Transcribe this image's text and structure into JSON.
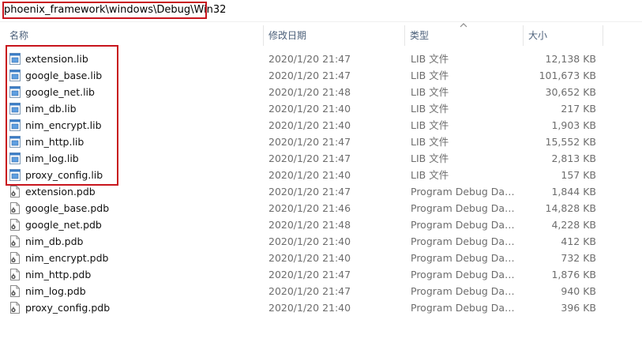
{
  "address": {
    "path": "phoenix_framework\\windows\\Debug\\Win32"
  },
  "columns": {
    "name": "名称",
    "date": "修改日期",
    "type": "类型",
    "size": "大小"
  },
  "files": [
    {
      "name": "extension.lib",
      "date": "2020/1/20 21:47",
      "type": "LIB 文件",
      "size": "12,138 KB",
      "icon": "lib-file-icon"
    },
    {
      "name": "google_base.lib",
      "date": "2020/1/20 21:47",
      "type": "LIB 文件",
      "size": "101,673 KB",
      "icon": "lib-file-icon"
    },
    {
      "name": "google_net.lib",
      "date": "2020/1/20 21:48",
      "type": "LIB 文件",
      "size": "30,652 KB",
      "icon": "lib-file-icon"
    },
    {
      "name": "nim_db.lib",
      "date": "2020/1/20 21:40",
      "type": "LIB 文件",
      "size": "217 KB",
      "icon": "lib-file-icon"
    },
    {
      "name": "nim_encrypt.lib",
      "date": "2020/1/20 21:40",
      "type": "LIB 文件",
      "size": "1,903 KB",
      "icon": "lib-file-icon"
    },
    {
      "name": "nim_http.lib",
      "date": "2020/1/20 21:47",
      "type": "LIB 文件",
      "size": "15,552 KB",
      "icon": "lib-file-icon"
    },
    {
      "name": "nim_log.lib",
      "date": "2020/1/20 21:47",
      "type": "LIB 文件",
      "size": "2,813 KB",
      "icon": "lib-file-icon"
    },
    {
      "name": "proxy_config.lib",
      "date": "2020/1/20 21:40",
      "type": "LIB 文件",
      "size": "157 KB",
      "icon": "lib-file-icon"
    },
    {
      "name": "extension.pdb",
      "date": "2020/1/20 21:47",
      "type": "Program Debug Data...",
      "size": "1,844 KB",
      "icon": "pdb-file-icon"
    },
    {
      "name": "google_base.pdb",
      "date": "2020/1/20 21:46",
      "type": "Program Debug Data...",
      "size": "14,828 KB",
      "icon": "pdb-file-icon"
    },
    {
      "name": "google_net.pdb",
      "date": "2020/1/20 21:48",
      "type": "Program Debug Data...",
      "size": "4,228 KB",
      "icon": "pdb-file-icon"
    },
    {
      "name": "nim_db.pdb",
      "date": "2020/1/20 21:40",
      "type": "Program Debug Data...",
      "size": "412 KB",
      "icon": "pdb-file-icon"
    },
    {
      "name": "nim_encrypt.pdb",
      "date": "2020/1/20 21:40",
      "type": "Program Debug Data...",
      "size": "732 KB",
      "icon": "pdb-file-icon"
    },
    {
      "name": "nim_http.pdb",
      "date": "2020/1/20 21:47",
      "type": "Program Debug Data...",
      "size": "1,876 KB",
      "icon": "pdb-file-icon"
    },
    {
      "name": "nim_log.pdb",
      "date": "2020/1/20 21:47",
      "type": "Program Debug Data...",
      "size": "940 KB",
      "icon": "pdb-file-icon"
    },
    {
      "name": "proxy_config.pdb",
      "date": "2020/1/20 21:40",
      "type": "Program Debug Data...",
      "size": "396 KB",
      "icon": "pdb-file-icon"
    }
  ],
  "colors": {
    "highlight": "#c8151d",
    "header_text": "#4c607a",
    "secondary_text": "#6d6d6d"
  }
}
